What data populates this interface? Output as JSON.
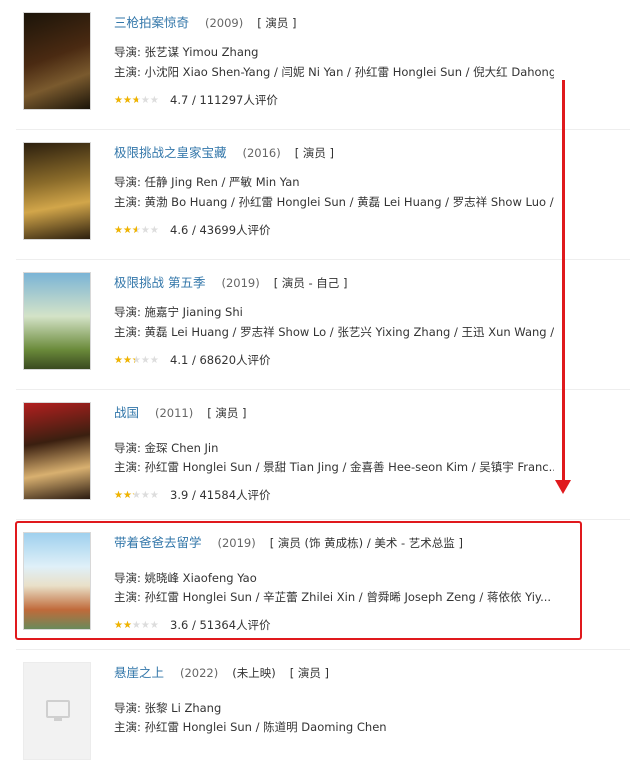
{
  "accent_color": "#e0191d",
  "link_color": "#3377aa",
  "star_color": "#f0b400",
  "labels": {
    "director_prefix": "导演: ",
    "cast_prefix": "主演: "
  },
  "items": [
    {
      "title": "三枪拍案惊奇",
      "year": "(2009)",
      "role": "[ 演员 ]",
      "director": "张艺谋 Yimou Zhang",
      "cast": "小沈阳 Xiao Shen-Yang / 闫妮 Ni Yan / 孙红雷 Honglei Sun / 倪大红 Dahong...",
      "rating": "4.7 / 111297人评价",
      "stars_fraction": 0.47,
      "poster_colors": [
        "#1b1409",
        "#4a2a12",
        "#7a5a2e"
      ]
    },
    {
      "title": "极限挑战之皇家宝藏",
      "year": "(2016)",
      "role": "[ 演员 ]",
      "director": "任静 Jing Ren / 严敏 Min Yan",
      "cast": "黄渤 Bo Huang / 孙红雷 Honglei Sun / 黄磊 Lei Huang / 罗志祥 Show Luo / ...",
      "rating": "4.6 / 43699人评价",
      "stars_fraction": 0.46,
      "poster_colors": [
        "#2c1f0e",
        "#8a6b2a",
        "#d2a64a"
      ]
    },
    {
      "title": "极限挑战 第五季",
      "year": "(2019)",
      "role": "[ 演员 - 自己 ]",
      "director": "施嘉宁 Jianing Shi",
      "cast": "黄磊 Lei Huang / 罗志祥 Show Lo / 张艺兴 Yixing Zhang / 王迅 Xun Wang / ...",
      "rating": "4.1 / 68620人评价",
      "stars_fraction": 0.41,
      "poster_colors": [
        "#7bb4d6",
        "#d4e3c8",
        "#6a8a3a"
      ]
    },
    {
      "title": "战国",
      "year": "(2011)",
      "role": "[ 演员 ]",
      "director": "金琛 Chen Jin",
      "cast": "孙红雷 Honglei Sun / 景甜 Tian Jing / 金喜善 Hee-seon Kim / 吴镇宇 Franc...",
      "rating": "3.9 / 41584人评价",
      "stars_fraction": 0.39,
      "poster_colors": [
        "#b21f1f",
        "#3a1f10",
        "#d8b070"
      ]
    },
    {
      "title": "带着爸爸去留学",
      "year": "(2019)",
      "role": "[ 演员 (饰 黄成栋) / 美术 - 艺术总监 ]",
      "director": "姚晓峰 Xiaofeng Yao",
      "cast": "孙红雷 Honglei Sun / 辛芷蕾 Zhilei Xin / 曾舜晞 Joseph Zeng / 蒋依依 Yiy...",
      "rating": "3.6 / 51364人评价",
      "stars_fraction": 0.36,
      "poster_colors": [
        "#9fd0ee",
        "#e9e0c8",
        "#c06a3a"
      ]
    },
    {
      "title": "悬崖之上",
      "year": "(2022)",
      "status": "(未上映)",
      "role": "[ 演员 ]",
      "director": "张黎 Li Zhang",
      "cast": "孙红雷 Honglei Sun / 陈道明 Daoming Chen",
      "poster_icon": "image-placeholder-icon"
    }
  ]
}
